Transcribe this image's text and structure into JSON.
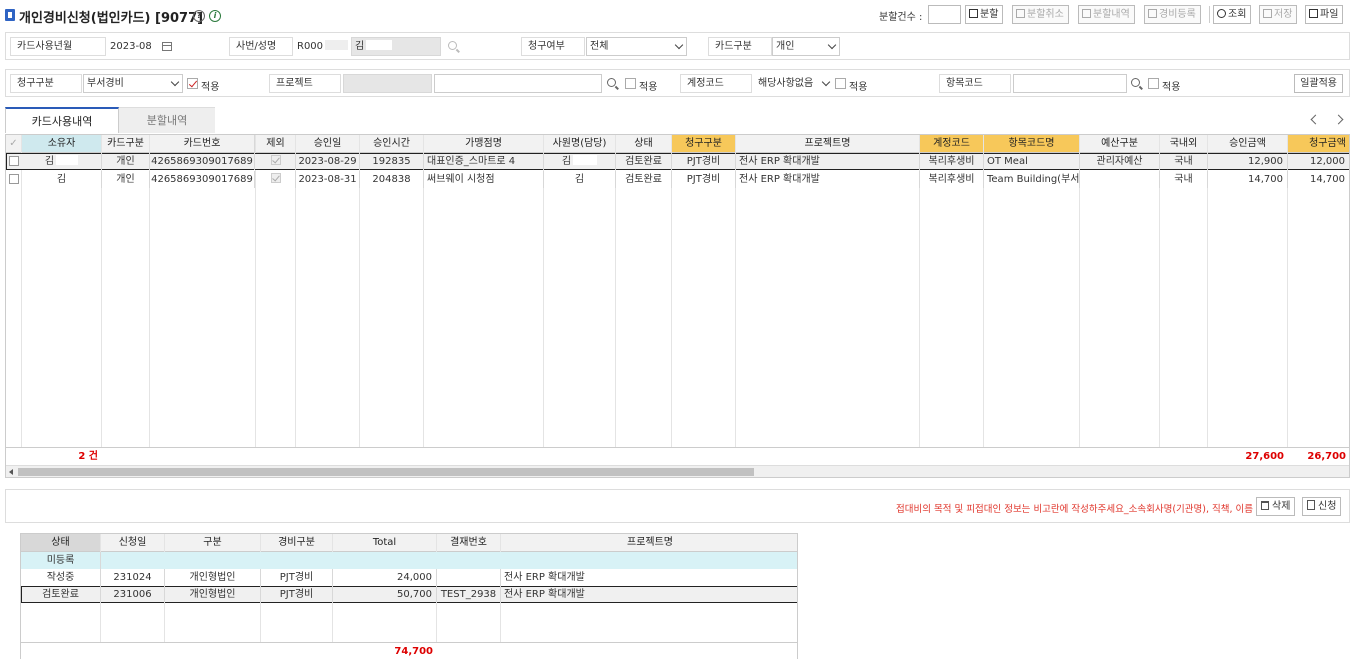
{
  "title": "개인경비신청(법인카드) [9077]",
  "toolbar": {
    "split_count_label": "분할건수 :",
    "split": "분할",
    "split_cancel": "분할취소",
    "split_history": "분할내역",
    "expense_register": "경비등록",
    "search": "조회",
    "save": "저장",
    "file": "파일"
  },
  "filter1": {
    "card_month_label": "카드사용년월",
    "card_month_value": "2023-08",
    "emp_label": "사번/성명",
    "emp_id": "R000",
    "emp_name": "김",
    "claim_status_label": "청구여부",
    "claim_status_value": "전체",
    "card_type_label": "카드구분",
    "card_type_value": "개인"
  },
  "filter2": {
    "claim_type_label": "청구구분",
    "claim_type_value": "부서경비",
    "apply": "적용",
    "project_label": "프로젝트",
    "account_label": "계정코드",
    "account_value": "해당사항없음",
    "item_label": "항목코드",
    "apply_all": "일괄적용"
  },
  "tabs": [
    "카드사용내역",
    "분할내역"
  ],
  "card_grid": {
    "headers": [
      "소유자",
      "카드구분",
      "카드번호",
      "제외",
      "승인일",
      "승인시간",
      "가맹점명",
      "사원명(담당)",
      "상태",
      "청구구분",
      "프로젝트명",
      "계정코드",
      "항목코드명",
      "예산구분",
      "국내외",
      "승인금액",
      "청구금액"
    ],
    "rows": [
      [
        "김",
        "개인",
        "4265869309017689",
        "",
        "2023-08-29",
        "192835",
        "대표인증_스마트로 4",
        "김",
        "검토완료",
        "PJT경비",
        "전사 ERP 확대개발",
        "복리후생비",
        "OT Meal",
        "관리자예산",
        "국내",
        "12,900",
        "12,000"
      ],
      [
        "김",
        "개인",
        "4265869309017689",
        "",
        "2023-08-31",
        "204838",
        "써브웨이 시청점",
        "김",
        "검토완료",
        "PJT경비",
        "전사 ERP 확대개발",
        "복리후생비",
        "Team Building(부서예",
        "",
        "국내",
        "14,700",
        "14,700"
      ]
    ],
    "footer_count": "2 건",
    "footer_approved_total": "27,600",
    "footer_claim_total": "26,700"
  },
  "action_bar": {
    "notice": "접대비의 목적 및 피접대인 정보는 비고란에 작성하주세요_소속회사명(기관명), 직책, 이름",
    "delete": "삭제",
    "submit": "신청"
  },
  "request_grid": {
    "headers": [
      "상태",
      "신청일",
      "구분",
      "경비구분",
      "Total",
      "결재번호",
      "프로젝트명"
    ],
    "rows": [
      [
        "미등록",
        "",
        "",
        "",
        "",
        "",
        ""
      ],
      [
        "작성중",
        "231024",
        "개인형법인",
        "PJT경비",
        "24,000",
        "",
        "전사 ERP 확대개발"
      ],
      [
        "검토완료",
        "231006",
        "개인형법인",
        "PJT경비",
        "50,700",
        "TEST_2938",
        "전사 ERP 확대개발"
      ]
    ],
    "footer_total": "74,700"
  }
}
